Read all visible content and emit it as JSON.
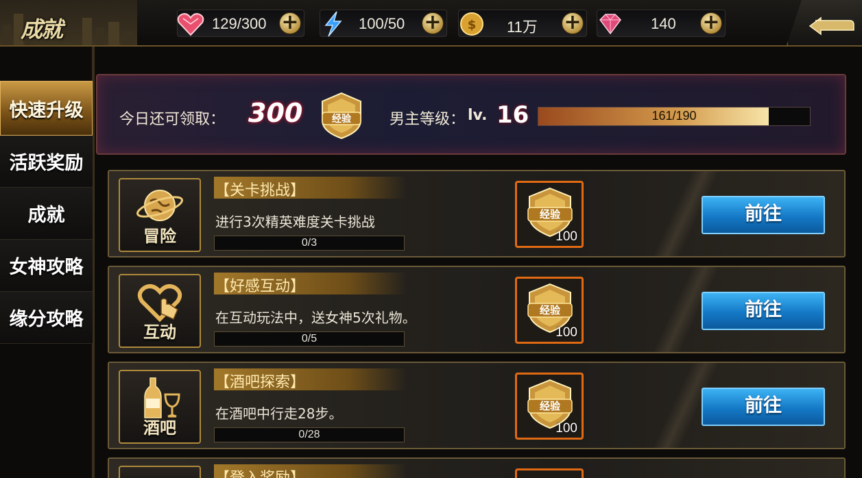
{
  "logo": {
    "text": "成就"
  },
  "resources": [
    {
      "name": "hearts",
      "value": "129/300",
      "icon": "heart-gem-icon"
    },
    {
      "name": "energy",
      "value": "100/50",
      "icon": "lightning-icon"
    },
    {
      "name": "gold",
      "value": "11万",
      "icon": "gold-coin-icon"
    },
    {
      "name": "diamonds",
      "value": "140",
      "icon": "diamond-icon"
    }
  ],
  "sidebar": {
    "items": [
      {
        "label": "快速升级",
        "active": true
      },
      {
        "label": "活跃奖励"
      },
      {
        "label": "成就"
      },
      {
        "label": "女神攻略"
      },
      {
        "label": "缘分攻略"
      }
    ]
  },
  "header": {
    "today_label": "今日还可领取：",
    "today_value": "300",
    "badge_text": "经验",
    "level_label": "男主等级：",
    "level_prefix": "lv.",
    "level_value": "16",
    "xp_current": 161,
    "xp_max": 190,
    "xp_text": "161/190"
  },
  "tasks": [
    {
      "icon_caption": "冒险",
      "title": "【关卡挑战】",
      "desc": "进行3次精英难度关卡挑战",
      "progress": "0/3",
      "reward_label": "经验",
      "reward_count": "100",
      "button": "前往"
    },
    {
      "icon_caption": "互动",
      "title": "【好感互动】",
      "desc": "在互动玩法中，送女神5次礼物。",
      "progress": "0/5",
      "reward_label": "经验",
      "reward_count": "100",
      "button": "前往"
    },
    {
      "icon_caption": "酒吧",
      "title": "【酒吧探索】",
      "desc": "在酒吧中行走28步。",
      "progress": "0/28",
      "reward_label": "经验",
      "reward_count": "100",
      "button": "前往"
    },
    {
      "title": "【登入奖励】"
    }
  ]
}
